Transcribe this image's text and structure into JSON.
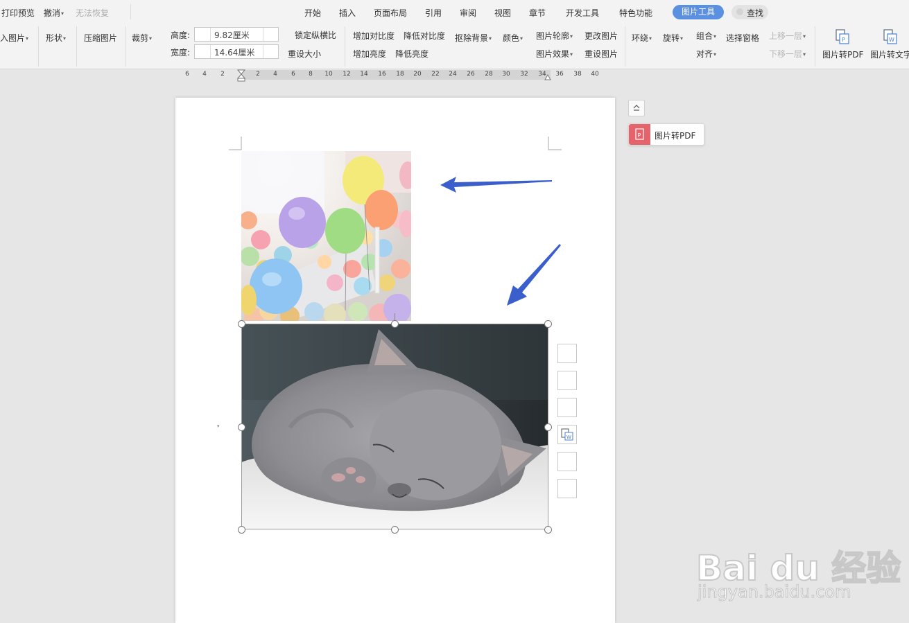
{
  "menubar": {
    "left_items": [
      "打印预览",
      "撤消",
      "无法恢复"
    ],
    "tabs": [
      "开始",
      "插入",
      "页面布局",
      "引用",
      "审阅",
      "视图",
      "章节",
      "开发工具",
      "特色功能"
    ],
    "active_tab": "图片工具",
    "find": "查找"
  },
  "ribbon": {
    "insert_picture": "入图片",
    "shape": "形状",
    "compress": "压缩图片",
    "crop": "裁剪",
    "height_label": "高度:",
    "height_value": "9.82厘米",
    "width_label": "宽度:",
    "width_value": "14.64厘米",
    "lock_ratio": "锁定纵横比",
    "reset_size": "重设大小",
    "inc_contrast": "增加对比度",
    "dec_contrast": "降低对比度",
    "inc_brightness": "增加亮度",
    "dec_brightness": "降低亮度",
    "remove_bg": "抠除背景",
    "color": "颜色",
    "outline": "图片轮廓",
    "effects": "图片效果",
    "change_pic": "更改图片",
    "reset_pic": "重设图片",
    "wrap": "环绕",
    "rotate": "旋转",
    "group": "组合",
    "align": "对齐",
    "selection_pane": "选择窗格",
    "bring_forward": "上移一层",
    "send_backward": "下移一层",
    "pic_to_pdf": "图片转PDF",
    "pic_to_text": "图片转文字"
  },
  "ruler": {
    "left_numbers": [
      "6",
      "4",
      "2"
    ],
    "right_numbers": [
      "2",
      "4",
      "6",
      "8",
      "10",
      "12",
      "14",
      "16",
      "18",
      "20",
      "22",
      "24",
      "26",
      "28",
      "30",
      "32",
      "34",
      "36",
      "38",
      "40"
    ]
  },
  "float_panel": {
    "pdf_label": "图片转PDF"
  },
  "watermark": {
    "logo": "Bai du 经验",
    "url": "jingyan.baidu.com"
  },
  "colors": {
    "accent": "#5b8fe0",
    "arrow": "#3a5fcd",
    "pdf_red": "#e5636a"
  }
}
